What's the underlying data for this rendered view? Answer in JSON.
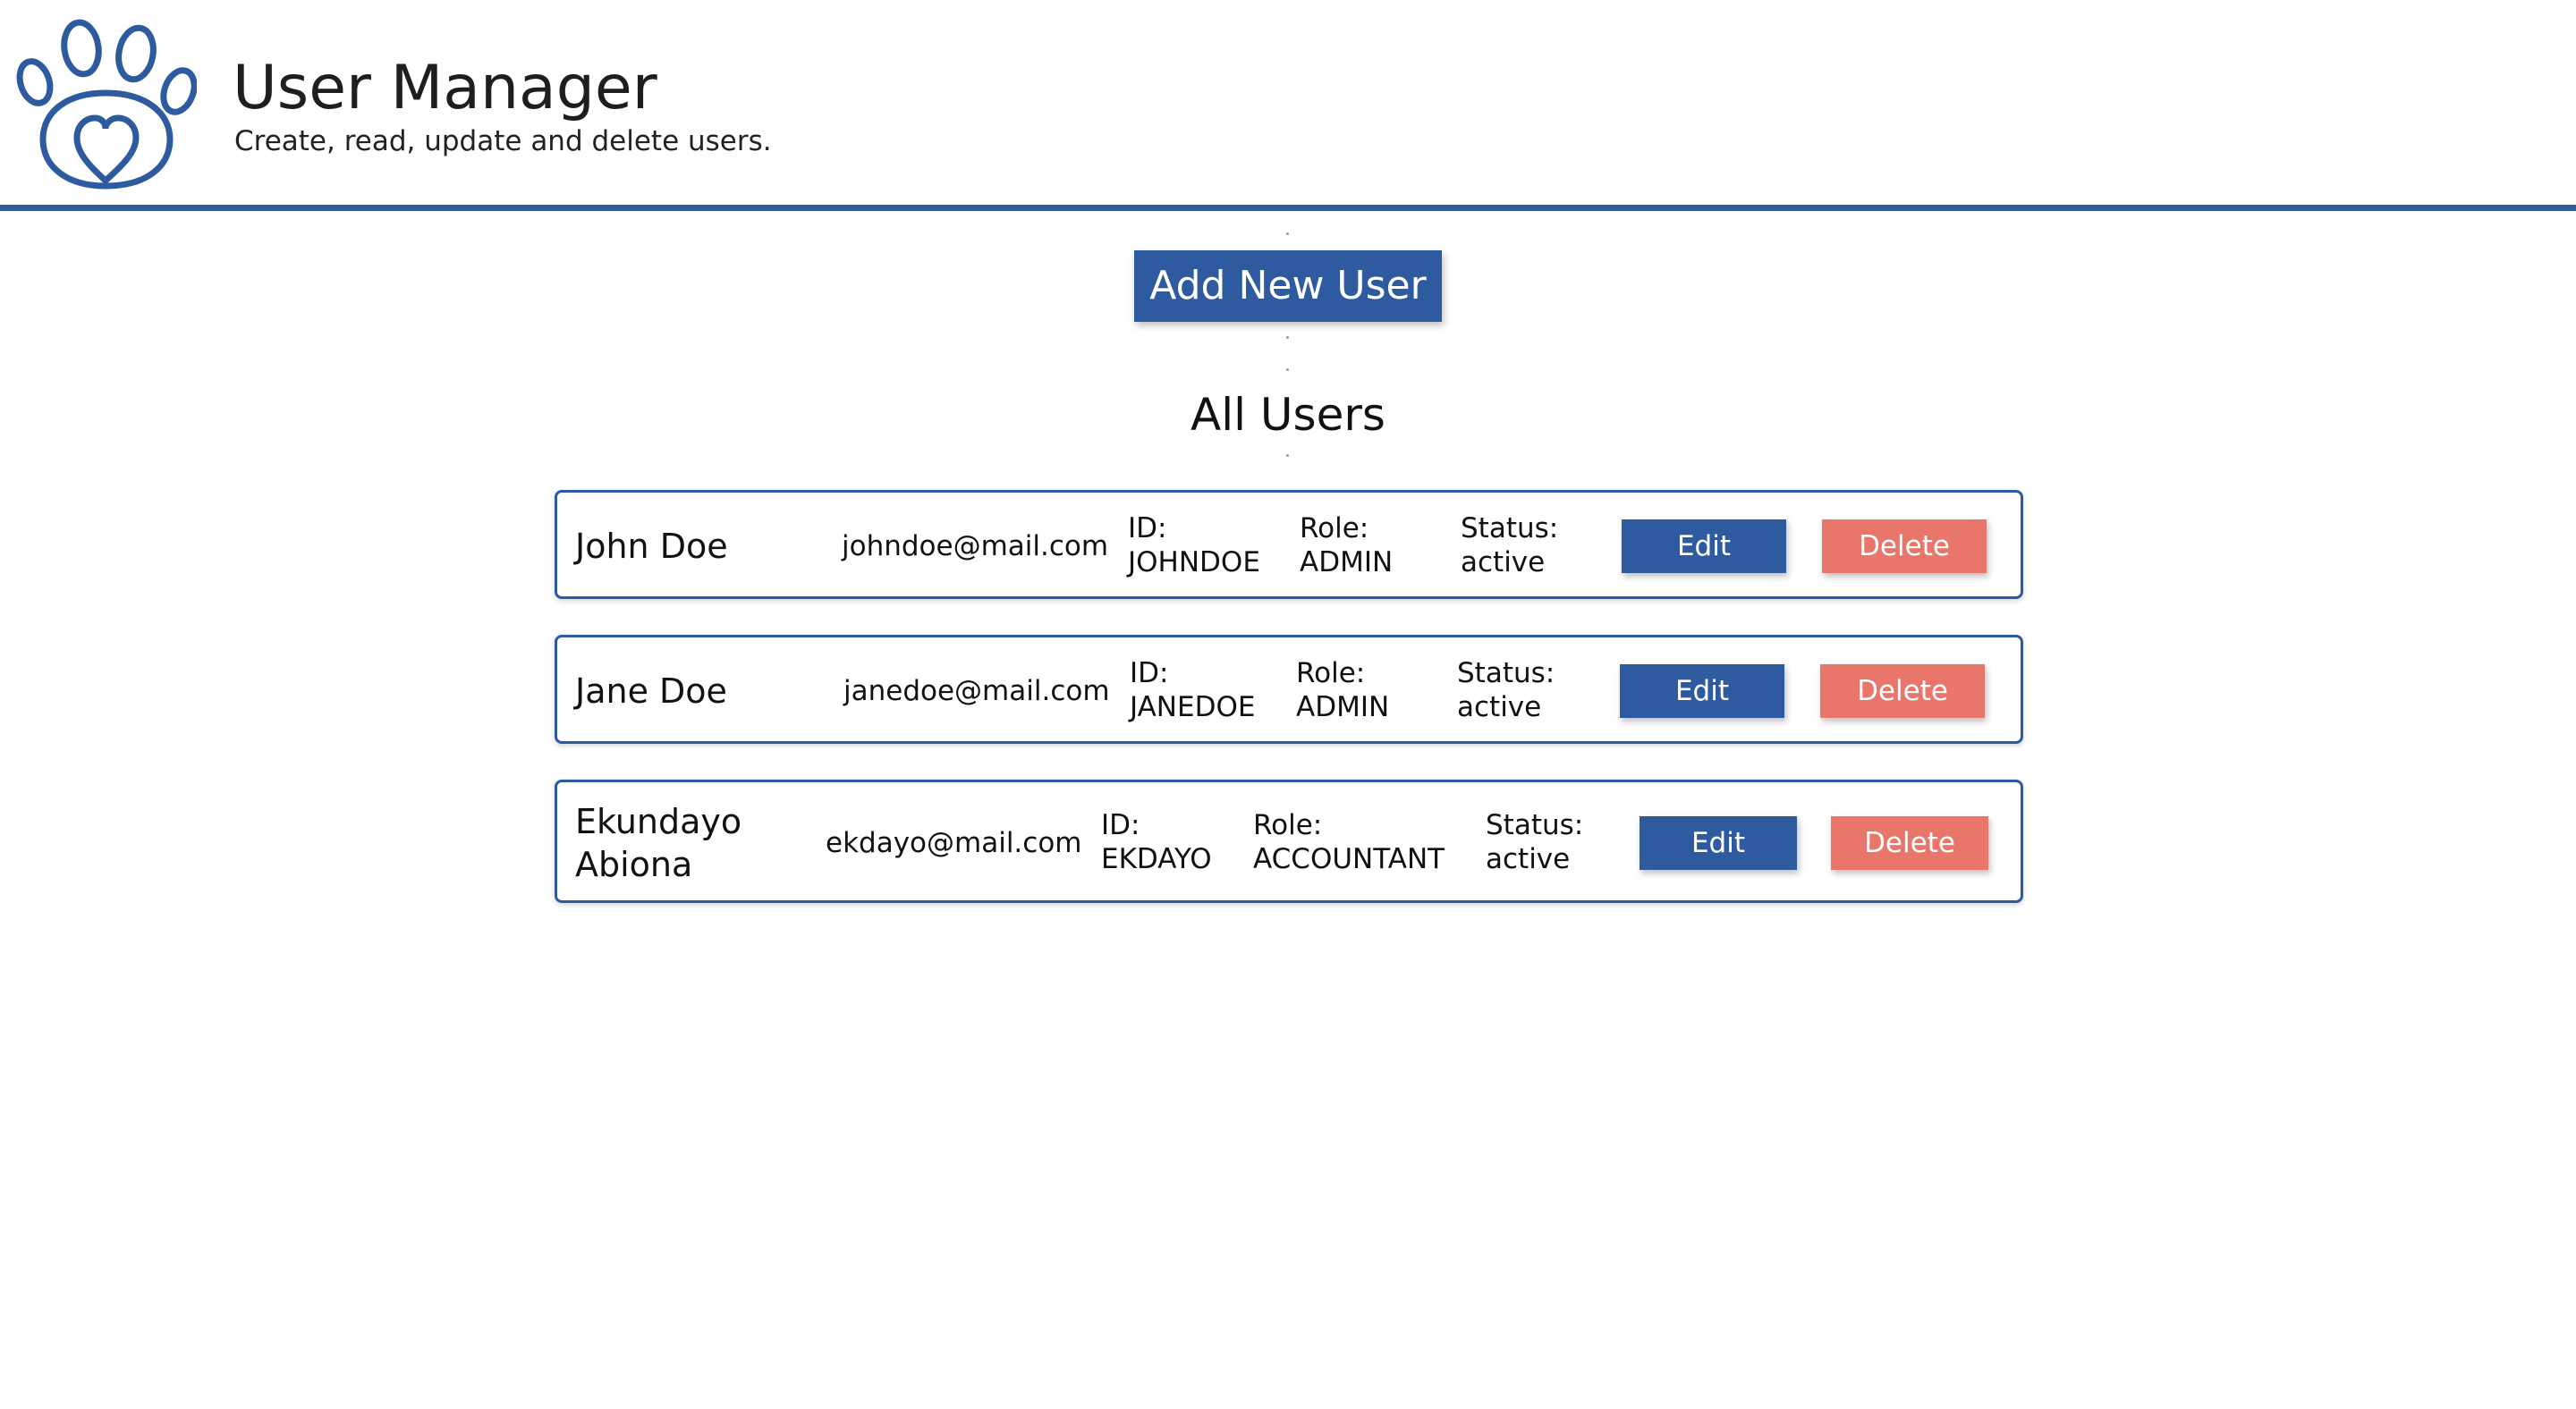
{
  "header": {
    "title": "User Manager",
    "subtitle": "Create, read, update and delete users.",
    "logo_icon": "paw-heart-icon",
    "accent_color": "#2e5aa0"
  },
  "actions": {
    "add_user_label": "Add New User"
  },
  "users_section": {
    "title": "All Users",
    "labels": {
      "id": "ID:",
      "role": "Role:",
      "status": "Status:"
    },
    "edit_label": "Edit",
    "delete_label": "Delete",
    "delete_color": "#e8766a"
  },
  "users": [
    {
      "name": "John Doe",
      "email": "johndoe@mail.com",
      "id": "JOHNDOE",
      "role": "ADMIN",
      "status": "active"
    },
    {
      "name": "Jane Doe",
      "email": "janedoe@mail.com",
      "id": "JANEDOE",
      "role": "ADMIN",
      "status": "active"
    },
    {
      "name_line1": "Ekundayo",
      "name_line2": "Abiona",
      "email": "ekdayo@mail.com",
      "id": "EKDAYO",
      "role": "ACCOUNTANT",
      "status": "active"
    }
  ]
}
